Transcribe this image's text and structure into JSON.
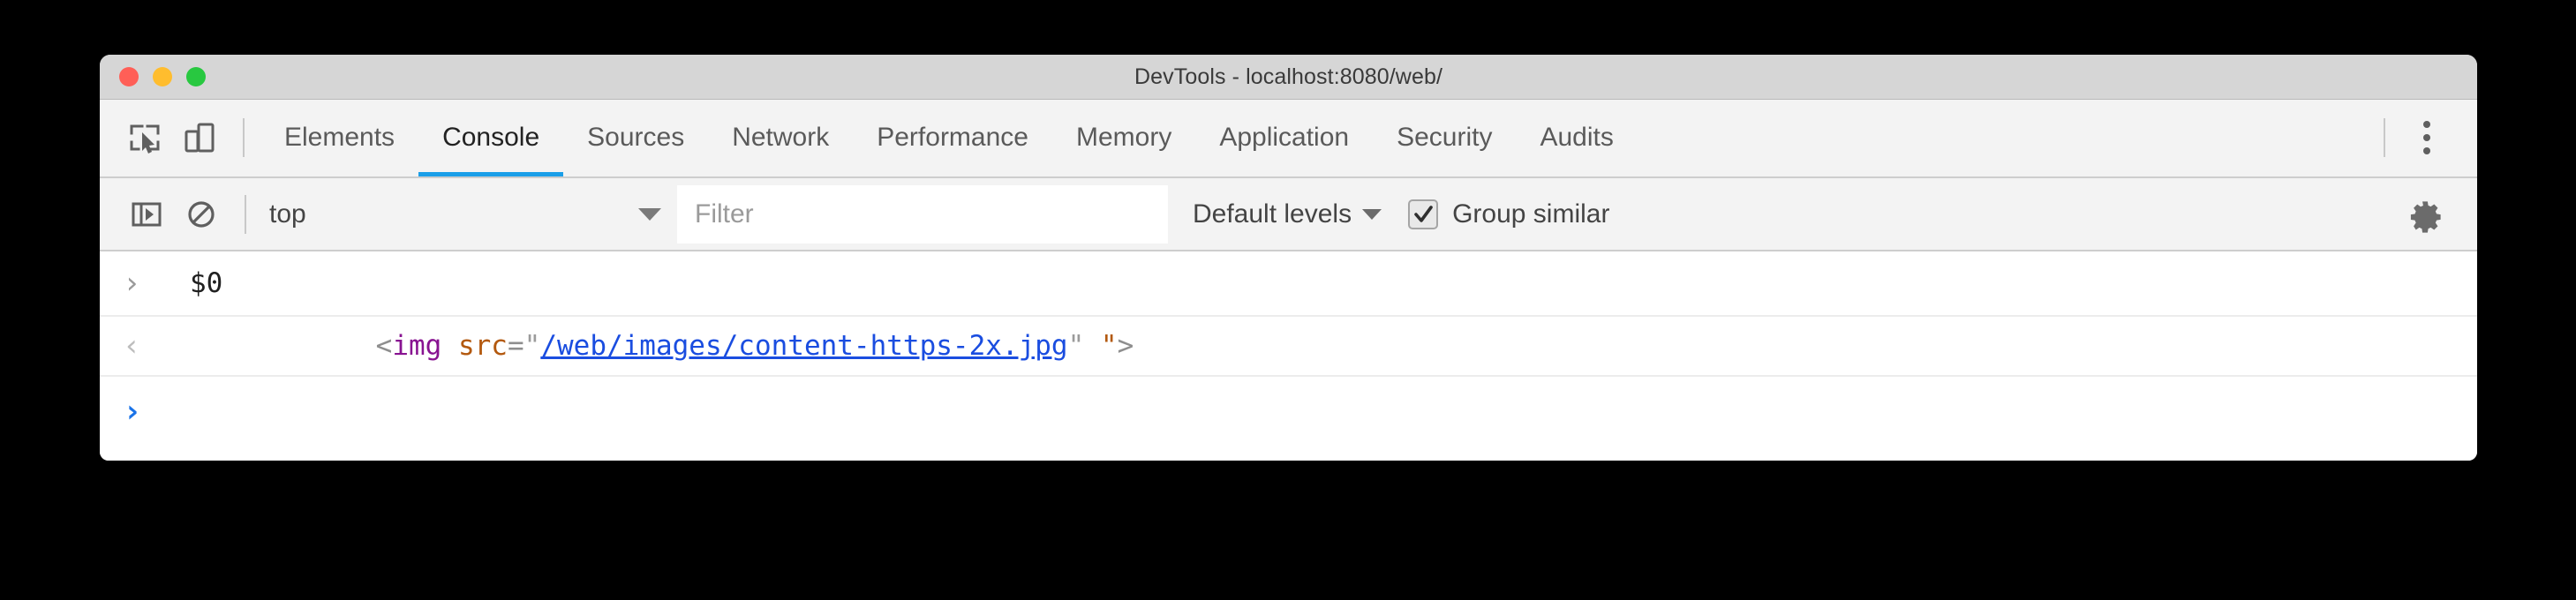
{
  "window": {
    "title": "DevTools - localhost:8080/web/",
    "traffic_lights": [
      {
        "name": "close",
        "color": "#ff5f57"
      },
      {
        "name": "minimize",
        "color": "#ffbd2e"
      },
      {
        "name": "zoom",
        "color": "#28c840"
      }
    ]
  },
  "tabbar": {
    "inspect_icon": "inspect-element-icon",
    "device_icon": "device-toolbar-icon",
    "more_icon": "more-options-icon",
    "active_tab": "Console",
    "tabs": [
      {
        "label": "Elements"
      },
      {
        "label": "Console"
      },
      {
        "label": "Sources"
      },
      {
        "label": "Network"
      },
      {
        "label": "Performance"
      },
      {
        "label": "Memory"
      },
      {
        "label": "Application"
      },
      {
        "label": "Security"
      },
      {
        "label": "Audits"
      }
    ]
  },
  "console_toolbar": {
    "sidebar_icon": "console-sidebar-icon",
    "clear_icon": "clear-console-icon",
    "context": {
      "value": "top",
      "caret": "chevron-down-icon"
    },
    "filter": {
      "value": "",
      "placeholder": "Filter"
    },
    "levels": {
      "label": "Default levels",
      "caret": "chevron-down-icon"
    },
    "group_similar": {
      "label": "Group similar",
      "checked": true
    },
    "settings_icon": "gear-icon"
  },
  "console_body": {
    "entries": [
      {
        "kind": "input",
        "marker": "›",
        "text": "$0"
      },
      {
        "kind": "output",
        "marker": "‹",
        "tokens": [
          {
            "type": "punct",
            "text": "<"
          },
          {
            "type": "tag",
            "text": "img"
          },
          {
            "type": "space",
            "text": " "
          },
          {
            "type": "attr",
            "text": "src"
          },
          {
            "type": "punct",
            "text": "="
          },
          {
            "type": "quote",
            "text": "\""
          },
          {
            "type": "link",
            "text": "/web/images/content-https-2x.jpg"
          },
          {
            "type": "quote",
            "text": "\""
          },
          {
            "type": "space",
            "text": " "
          },
          {
            "type": "quote2",
            "text": "\""
          },
          {
            "type": "gt",
            "text": ">"
          }
        ],
        "plain": "<img src=\"/web/images/content-https-2x.jpg\" \">"
      },
      {
        "kind": "prompt",
        "marker": "›",
        "text": ""
      }
    ]
  },
  "colors": {
    "accent_blue": "#1a9ee8",
    "titlebar_bg": "#d6d6d6",
    "toolbar_bg": "#f3f3f3",
    "body_bg": "#ffffff",
    "tag_purple": "#881391",
    "attr_orange": "#b3590f",
    "link_blue": "#1a4de0"
  }
}
